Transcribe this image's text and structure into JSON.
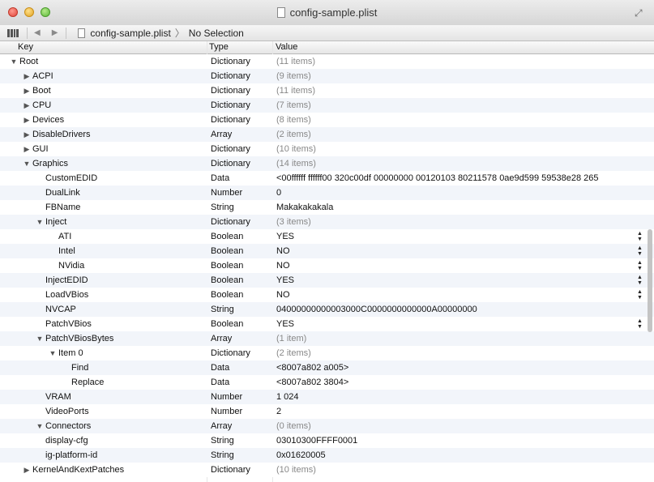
{
  "window": {
    "title": "config-sample.plist"
  },
  "pathbar": {
    "file": "config-sample.plist",
    "selection": "No Selection",
    "back_icon": "◀",
    "forward_icon": "▶",
    "separator": "〉"
  },
  "columns": {
    "key": "Key",
    "type": "Type",
    "value": "Value"
  },
  "rows": [
    {
      "key": "Root",
      "type": "Dictionary",
      "value": "(11 items)",
      "indent": 0,
      "disclosure": "open",
      "muted": true
    },
    {
      "key": "ACPI",
      "type": "Dictionary",
      "value": "(9 items)",
      "indent": 1,
      "disclosure": "closed",
      "muted": true
    },
    {
      "key": "Boot",
      "type": "Dictionary",
      "value": "(11 items)",
      "indent": 1,
      "disclosure": "closed",
      "muted": true
    },
    {
      "key": "CPU",
      "type": "Dictionary",
      "value": "(7 items)",
      "indent": 1,
      "disclosure": "closed",
      "muted": true
    },
    {
      "key": "Devices",
      "type": "Dictionary",
      "value": "(8 items)",
      "indent": 1,
      "disclosure": "closed",
      "muted": true
    },
    {
      "key": "DisableDrivers",
      "type": "Array",
      "value": "(2 items)",
      "indent": 1,
      "disclosure": "closed",
      "muted": true
    },
    {
      "key": "GUI",
      "type": "Dictionary",
      "value": "(10 items)",
      "indent": 1,
      "disclosure": "closed",
      "muted": true
    },
    {
      "key": "Graphics",
      "type": "Dictionary",
      "value": "(14 items)",
      "indent": 1,
      "disclosure": "open",
      "muted": true
    },
    {
      "key": "CustomEDID",
      "type": "Data",
      "value": "<00ffffff ffffff00 320c00df 00000000 00120103 80211578 0ae9d599 59538e28 265",
      "indent": 2,
      "disclosure": "none"
    },
    {
      "key": "DualLink",
      "type": "Number",
      "value": "0",
      "indent": 2,
      "disclosure": "none"
    },
    {
      "key": "FBName",
      "type": "String",
      "value": "Makakakakala",
      "indent": 2,
      "disclosure": "none"
    },
    {
      "key": "Inject",
      "type": "Dictionary",
      "value": "(3 items)",
      "indent": 2,
      "disclosure": "open",
      "muted": true
    },
    {
      "key": "ATI",
      "type": "Boolean",
      "value": "YES",
      "indent": 3,
      "disclosure": "none",
      "stepper": true
    },
    {
      "key": "Intel",
      "type": "Boolean",
      "value": "NO",
      "indent": 3,
      "disclosure": "none",
      "stepper": true
    },
    {
      "key": "NVidia",
      "type": "Boolean",
      "value": "NO",
      "indent": 3,
      "disclosure": "none",
      "stepper": true
    },
    {
      "key": "InjectEDID",
      "type": "Boolean",
      "value": "YES",
      "indent": 2,
      "disclosure": "none",
      "stepper": true
    },
    {
      "key": "LoadVBios",
      "type": "Boolean",
      "value": "NO",
      "indent": 2,
      "disclosure": "none",
      "stepper": true
    },
    {
      "key": "NVCAP",
      "type": "String",
      "value": "04000000000003000C0000000000000A00000000",
      "indent": 2,
      "disclosure": "none"
    },
    {
      "key": "PatchVBios",
      "type": "Boolean",
      "value": "YES",
      "indent": 2,
      "disclosure": "none",
      "stepper": true
    },
    {
      "key": "PatchVBiosBytes",
      "type": "Array",
      "value": "(1 item)",
      "indent": 2,
      "disclosure": "open",
      "muted": true
    },
    {
      "key": "Item 0",
      "type": "Dictionary",
      "value": "(2 items)",
      "indent": 3,
      "disclosure": "open",
      "muted": true
    },
    {
      "key": "Find",
      "type": "Data",
      "value": "<8007a802 a005>",
      "indent": 4,
      "disclosure": "none"
    },
    {
      "key": "Replace",
      "type": "Data",
      "value": "<8007a802 3804>",
      "indent": 4,
      "disclosure": "none"
    },
    {
      "key": "VRAM",
      "type": "Number",
      "value": "1 024",
      "indent": 2,
      "disclosure": "none"
    },
    {
      "key": "VideoPorts",
      "type": "Number",
      "value": "2",
      "indent": 2,
      "disclosure": "none"
    },
    {
      "key": "Connectors",
      "type": "Array",
      "value": "(0 items)",
      "indent": 2,
      "disclosure": "open",
      "muted": true
    },
    {
      "key": "display-cfg",
      "type": "String",
      "value": "03010300FFFF0001",
      "indent": 2,
      "disclosure": "none"
    },
    {
      "key": "ig-platform-id",
      "type": "String",
      "value": "0x01620005",
      "indent": 2,
      "disclosure": "none"
    },
    {
      "key": "KernelAndKextPatches",
      "type": "Dictionary",
      "value": "(10 items)",
      "indent": 1,
      "disclosure": "closed",
      "muted": true
    }
  ]
}
